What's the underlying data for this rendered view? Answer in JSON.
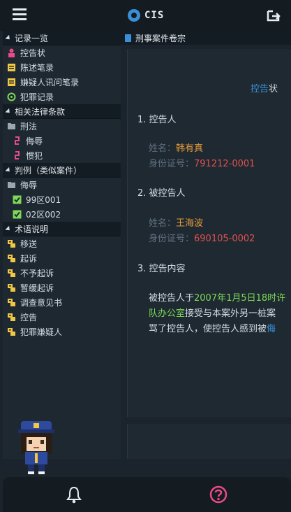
{
  "header": {
    "logo_text": "CIS",
    "logo_prefix": "x"
  },
  "sidebar": {
    "sections": [
      {
        "title": "记录一览",
        "items": [
          {
            "label": "控告状",
            "icon": "person-pink-icon"
          },
          {
            "label": "陈述笔录",
            "icon": "document-yellow-icon"
          },
          {
            "label": "嫌疑人讯问笔录",
            "icon": "document-yellow-icon"
          },
          {
            "label": "犯罪记录",
            "icon": "green-swirl-icon"
          }
        ]
      },
      {
        "title": "相关法律条款",
        "items": [
          {
            "label": "刑法",
            "icon": "folder-icon"
          },
          {
            "label": "侮辱",
            "icon": "pink-clip-icon"
          },
          {
            "label": "惯犯",
            "icon": "pink-clip-icon"
          }
        ]
      },
      {
        "title": "判例（类似案件）",
        "items": [
          {
            "label": "侮辱",
            "icon": "folder-icon"
          },
          {
            "label": "99区001",
            "icon": "green-check-icon"
          },
          {
            "label": "02区002",
            "icon": "green-check-icon"
          }
        ]
      },
      {
        "title": "术语说明",
        "items": [
          {
            "label": "移送",
            "icon": "term-yellow-icon"
          },
          {
            "label": "起诉",
            "icon": "term-yellow-icon"
          },
          {
            "label": "不予起诉",
            "icon": "term-yellow-icon"
          },
          {
            "label": "暂缓起诉",
            "icon": "term-yellow-icon"
          },
          {
            "label": "调查意见书",
            "icon": "term-yellow-icon"
          },
          {
            "label": "控告",
            "icon": "term-yellow-icon"
          },
          {
            "label": "犯罪嫌疑人",
            "icon": "term-yellow-icon"
          }
        ]
      }
    ]
  },
  "tab": {
    "title": "刑事案件卷宗"
  },
  "document": {
    "title_highlight": "控告",
    "title_rest": "状",
    "s1": "1. 控告人",
    "name_label": "姓名：",
    "complainant_name": "韩有真",
    "id_label": "身份证号：",
    "complainant_id": "791212-0001",
    "s2": "2. 被控告人",
    "defendant_name": "王海波",
    "defendant_id": "690105-0002",
    "s3": "3. 控告内容",
    "body_l1_a": "被控告人于",
    "body_l1_date": "2007年1月5日18时许",
    "body_l2_place": "队办公室",
    "body_l2_rest": "接受与本案外另一桩案",
    "body_l3": "骂了控告人，使控告人感到被",
    "body_l3_hl": "侮"
  },
  "colors": {
    "accent": "#3a8fd6",
    "name": "#e59a3a",
    "id": "#e0514e",
    "green": "#7ed957",
    "pink": "#e84a8a"
  }
}
